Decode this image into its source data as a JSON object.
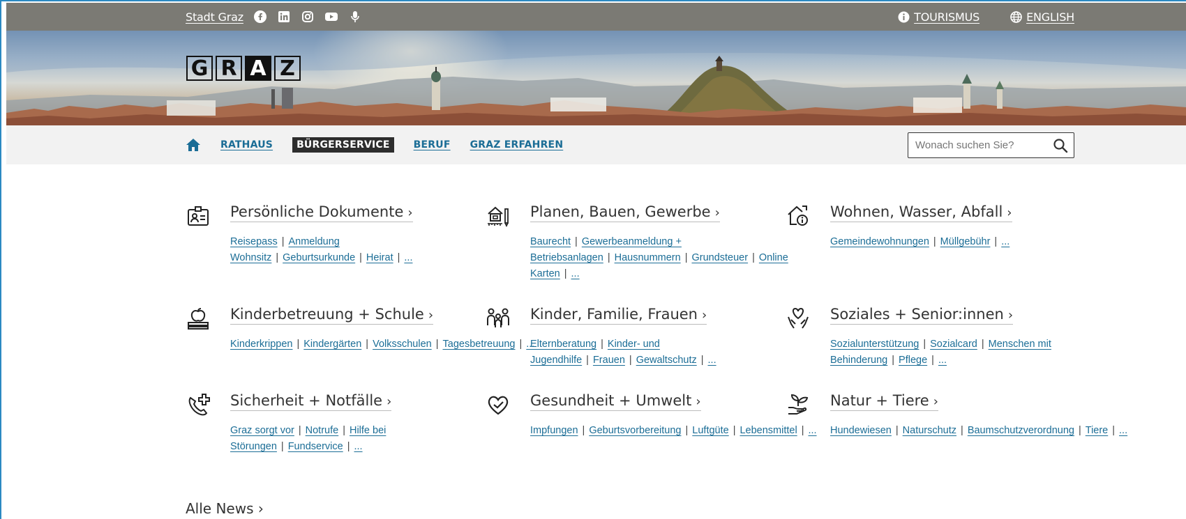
{
  "topbar": {
    "stadt_label": "Stadt Graz",
    "social_icons": [
      "facebook-icon",
      "linkedin-icon",
      "instagram-icon",
      "youtube-icon",
      "microphone-icon"
    ],
    "tourismus_label": "TOURISMUS",
    "english_label": "ENGLISH"
  },
  "logo": {
    "letters": [
      "G",
      "R",
      "A",
      "Z"
    ]
  },
  "nav": {
    "items": [
      {
        "label": "RATHAUS"
      },
      {
        "label": "BÜRGERSERVICE"
      },
      {
        "label": "BERUF"
      },
      {
        "label": "GRAZ ERFAHREN"
      }
    ],
    "search_placeholder": "Wonach suchen Sie?"
  },
  "categories": [
    {
      "title": "Persönliche Dokumente",
      "icon": "id-card-icon",
      "links": [
        "Reisepass",
        "Anmeldung Wohnsitz",
        "Geburtsurkunde",
        "Heirat",
        "..."
      ]
    },
    {
      "title": "Planen, Bauen, Gewerbe",
      "icon": "building-plan-icon",
      "links": [
        "Baurecht",
        "Gewerbeanmeldung + Betriebsanlagen",
        "Hausnummern",
        "Grundsteuer",
        "Online Karten",
        "..."
      ]
    },
    {
      "title": "Wohnen, Wasser, Abfall",
      "icon": "house-info-icon",
      "links": [
        "Gemeindewohnungen",
        "Müllgebühr",
        "..."
      ]
    },
    {
      "title": "Kinderbetreuung + Schule",
      "icon": "school-apple-icon",
      "links": [
        "Kinderkrippen",
        "Kindergärten",
        "Volksschulen",
        "Tagesbetreuung",
        "..."
      ]
    },
    {
      "title": "Kinder, Familie, Frauen",
      "icon": "family-icon",
      "links": [
        "Elternberatung",
        "Kinder- und Jugendhilfe",
        "Frauen",
        "Gewaltschutz",
        "..."
      ]
    },
    {
      "title": "Soziales + Senior:innen",
      "icon": "heart-hands-icon",
      "links": [
        "Sozialunterstützung",
        "Sozialcard",
        "Menschen mit Behinderung",
        "Pflege",
        "..."
      ]
    },
    {
      "title": "Sicherheit + Notfälle",
      "icon": "phone-cross-icon",
      "links": [
        "Graz sorgt vor",
        "Notrufe",
        "Hilfe bei Störungen",
        "Fundservice",
        "..."
      ]
    },
    {
      "title": "Gesundheit + Umwelt",
      "icon": "heart-check-icon",
      "links": [
        "Impfungen",
        "Geburtsvorbereitung",
        "Luftgüte",
        "Lebensmittel",
        "..."
      ]
    },
    {
      "title": "Natur + Tiere",
      "icon": "plant-hand-icon",
      "links": [
        "Hundewiesen",
        "Naturschutz",
        "Baumschutzverordnung",
        "Tiere",
        "..."
      ]
    }
  ],
  "all_news_label": "Alle News ›",
  "chevron": "›",
  "colors": {
    "link": "#1b6d96",
    "topbar": "#7b7a74",
    "nav_bg": "#f2f2f2",
    "active_nav": "#2d2d2d"
  }
}
